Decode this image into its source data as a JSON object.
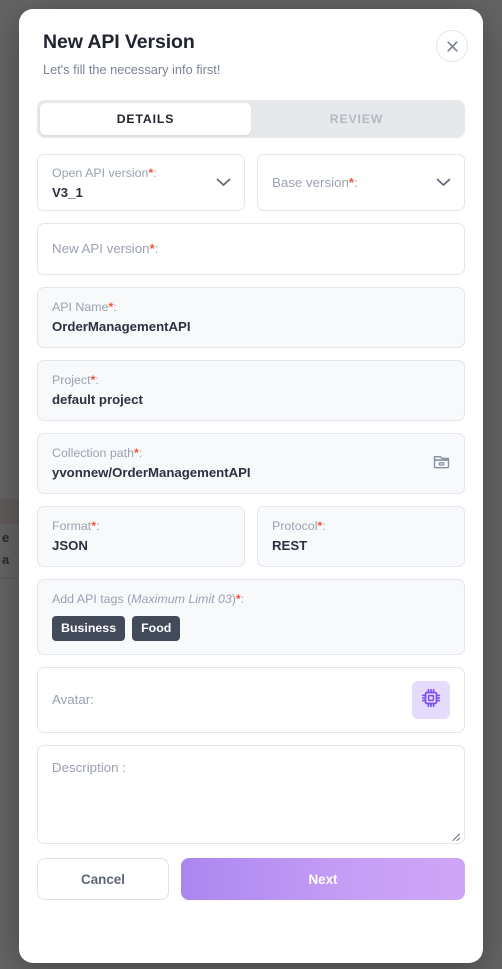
{
  "overlay": {
    "background_text_1": "e",
    "background_text_2": "a"
  },
  "modal": {
    "title": "New API Version",
    "subtitle": "Let's fill the necessary info first!",
    "close_icon": "close-icon",
    "accent_color": "#c39cf5",
    "required_marker_color": "#f0563a"
  },
  "tabs": [
    {
      "label": "DETAILS",
      "active": true
    },
    {
      "label": "REVIEW",
      "active": false
    }
  ],
  "fields": {
    "open_api_version": {
      "label": "Open API version",
      "required": "*",
      "colon": ":",
      "value": "V3_1",
      "icon": "chevron-down-icon"
    },
    "base_version": {
      "label": "Base version",
      "required": "*",
      "colon": ":",
      "value": "",
      "icon": "chevron-down-icon"
    },
    "new_api_version": {
      "label": "New API version",
      "required": "*",
      "colon": ":",
      "value": ""
    },
    "api_name": {
      "label": "API Name",
      "required": "*",
      "colon": ":",
      "value": "OrderManagementAPI"
    },
    "project": {
      "label": "Project",
      "required": "*",
      "colon": ":",
      "value": "default project"
    },
    "collection_path": {
      "label": "Collection path",
      "required": "*",
      "colon": ":",
      "value": "yvonnew/OrderManagementAPI",
      "icon": "folder-icon"
    },
    "format": {
      "label": "Format",
      "required": "*",
      "colon": ":",
      "value": "JSON"
    },
    "protocol": {
      "label": "Protocol",
      "required": "*",
      "colon": ":",
      "value": "REST"
    },
    "api_tags": {
      "label_prefix": "Add API tags (",
      "label_emphasis": "Maximum Limit 03",
      "label_suffix": ")",
      "required": "*",
      "colon": ":",
      "tags": [
        "Business",
        "Food"
      ]
    },
    "avatar": {
      "label": "Avatar:",
      "icon": "cpu-chip-icon",
      "icon_color": "#7c4df0"
    },
    "description": {
      "label": "Description :",
      "value": ""
    }
  },
  "footer": {
    "cancel_label": "Cancel",
    "next_label": "Next"
  }
}
